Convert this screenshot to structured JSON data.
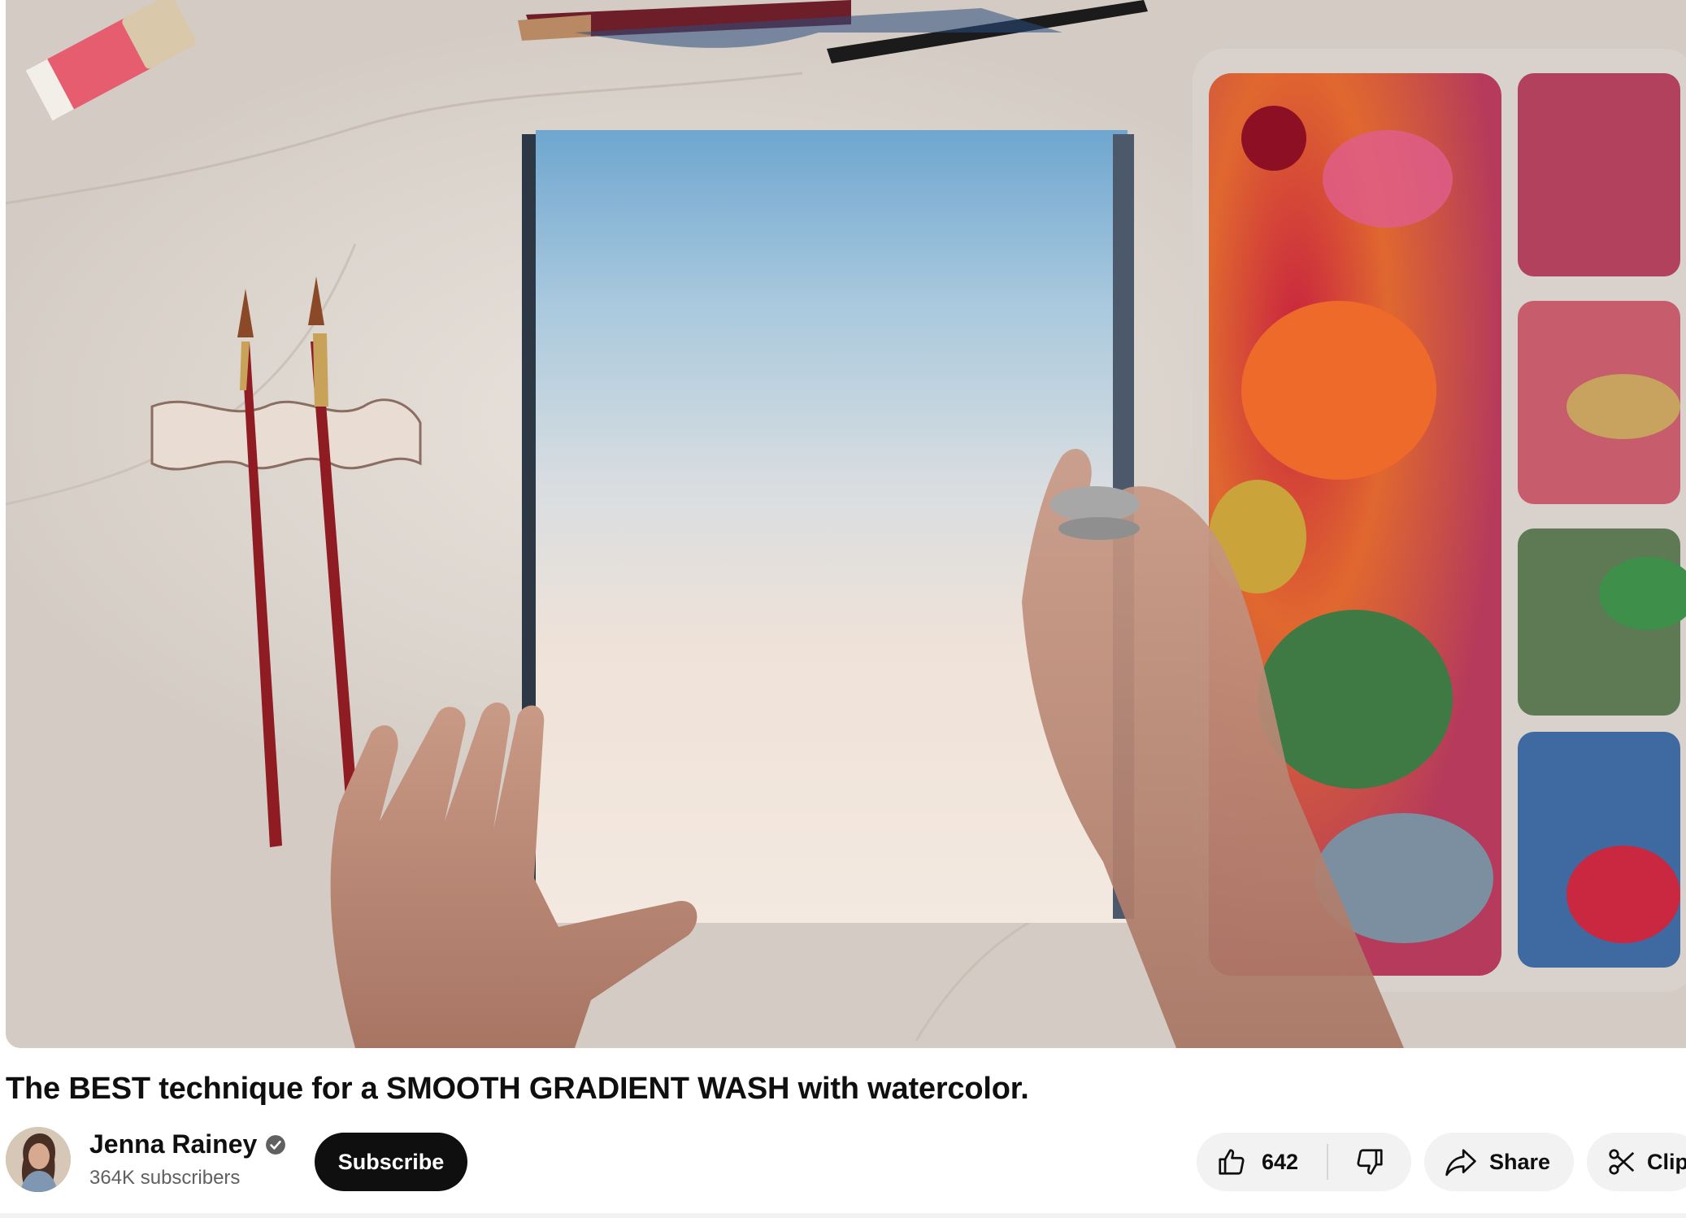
{
  "video": {
    "description_icon": "watercolor-painting-frame"
  },
  "title": "The BEST technique for a SMOOTH GRADIENT WASH with watercolor.",
  "channel": {
    "name": "Jenna Rainey",
    "subscribers": "364K subscribers",
    "verified_icon": "verified-check-icon",
    "avatar_icon": "channel-avatar"
  },
  "actions": {
    "subscribe_label": "Subscribe",
    "like_count": "642",
    "like_icon": "thumbs-up-icon",
    "dislike_icon": "thumbs-down-icon",
    "share_label": "Share",
    "share_icon": "share-arrow-icon",
    "clip_label": "Clip",
    "clip_icon": "scissors-icon"
  },
  "colors": {
    "subscribe_bg": "#0f0f0f",
    "pill_bg": "#f2f2f2",
    "secondary_text": "#606060"
  }
}
